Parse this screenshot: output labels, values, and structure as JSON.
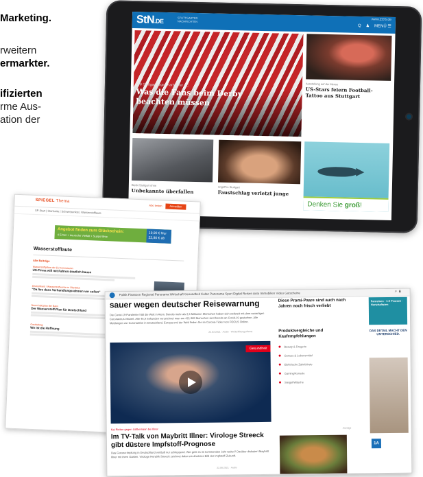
{
  "promo": {
    "line1": "Marketing.",
    "line2": "rweitern",
    "line3": "ermarkter.",
    "line4": "ifizierten",
    "line5": "rme Aus-",
    "line6": "ation der"
  },
  "tablet": {
    "logo": "StN",
    "logo_suffix": ".DE",
    "logo_sub": "STUTTGARTER NACHRICHTEN",
    "domain": "www.ZOS.de",
    "nav_search": "Q",
    "nav_user": "♟",
    "nav_menu": "MENÜ ☰",
    "hero_kicker": "VfB Stuttgart gegen Karlsruher SC",
    "hero_title": "Was die Fans beim Derby beachten müssen",
    "side_kicker": "Ausstellung auf der Messe",
    "side_title": "US-Stars feiern Football-Tattoo aus Stuttgart",
    "tile1_kicker": "Bleibt Stuttgart ohne",
    "tile1_title": "Unbekannte überfallen",
    "tile2_kicker": "Angriff in Stuttgart",
    "tile2_title": "Faustschlag verletzt junge",
    "ad_text_1": "Denken Sie",
    "ad_text_2": "groß",
    "ad_text_3": "!"
  },
  "spiegel": {
    "logo": "SPIEGEL",
    "logo_sub": "Thema",
    "abo_label": "Abo testen",
    "anmelden": "Anmelden",
    "nav": "SP-Start   |   Startseite   |   Schwerpunkte   |   Wasserstofflaute",
    "banner_a": "Angebot finden zum Glückschein:",
    "banner_b": "4 Eimer + deutsche Vielfalt + Supportlinie",
    "banner_price": "19,90 € Nur 22,90 € ab",
    "ressort": "Wasserstofflaute",
    "section": "Alle Beiträge",
    "items": [
      {
        "kicker": "Wasserstoffpläne der EU-Kommission",
        "title": "US-Firma will mit Fahren deutlich bauen"
      },
      {
        "kicker": "Deutschland / Wasserstoffwerke im Überblick",
        "title": "\"Da lies dass Verhandlungsrahmen vor sollen\""
      },
      {
        "kicker": "Neuer Netzplan der Bahn",
        "title": "Der Wasserstoff-Plan für Deutschland"
      },
      {
        "kicker": "Gastbeitrag",
        "title": "Wo ist die Hoffnung"
      }
    ]
  },
  "news": {
    "menu": "Politik  Finanzen  Regional  Panorama  Wirtschaft  Gesundheit  Kultur  Panorama  Sport  Digital  Reisen  Auto  Immobilien  Video  Gutscheine",
    "headline": "sauer wegen deutscher Reisewarnung",
    "lead": "Die Covid-19-Pandemie hält die Welt in Atem. Bereits mehr als 2,6 Millionen Menschen haben sich weltweit mit dem neuartigen Coronavirus infiziert. Alle 46,9 Sekunden verzeichnet man am 421 883 Menschen sind bereits an Covid-19 gestorben. Alle Meldungen zur Coronakrise in Deutschland, Europa und der Welt finden Sie im Corona-Ticker von FOCUS Online.",
    "date1": "22.03.2021 · Audio · Weiterleitungsdienst",
    "badge": "Gesundheit",
    "kicker2": "Kai Rieber gegen Lüttkemann bei Illner",
    "headline2": "Im TV-Talk von Maybritt Illner: Virologe Streeck gibt düstere Impfstoff-Prognose",
    "lead2": "Das Corona-Impfung in Deutschland verläuft nur schleppend. Wie geht es im kommenden Jahr weiter? Darüber diskutiert Maybritt Illner mit ihren Gästen. Virologe Hendrik Streeck zeichnet dabei ein düsteres Bild der Impfstoff-Zukunft.",
    "date2": "22.06.2021 · Audio",
    "promi": "Diese Promi-Paare sind auch nach Jahren noch frisch verliebt",
    "prod_title": "Produktvergleiche und Kaufempfehlungen",
    "prod_items": [
      "Beauty & Drogerie",
      "Genuss & Lebensmittel",
      "Elektrische Zahnbürste",
      "Gaming/Konsole",
      "Steigel/Wäsche"
    ],
    "anzeige": "Anzeige",
    "ad1_a": "Fanreisen · 1:0 Prozent · Hertzhaftsten",
    "ad2": "DAS DETAIL MACHT DEN UNTERSCHIED.",
    "ad4": "1A"
  }
}
